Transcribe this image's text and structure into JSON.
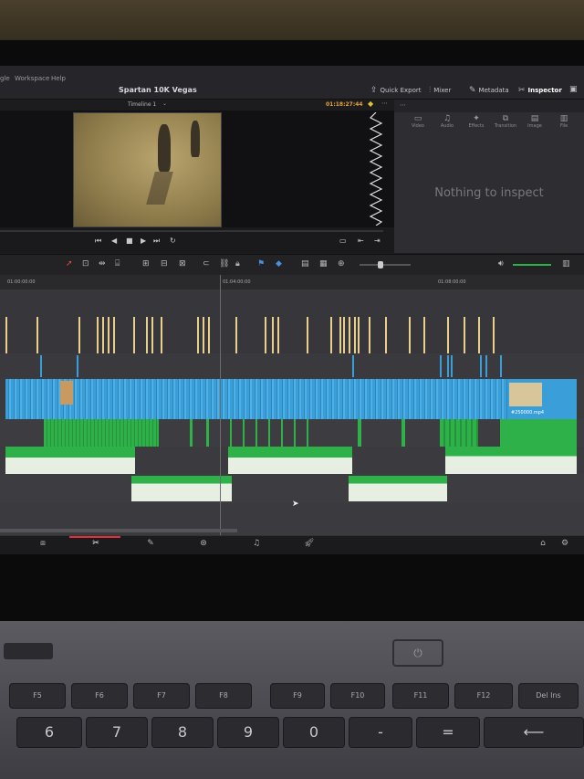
{
  "menu": [
    "gle",
    "Workspace",
    "Help"
  ],
  "project_title": "Spartan 10K Vegas",
  "toolbar_right": [
    {
      "icon": "quick-export-icon",
      "label": "Quick Export"
    },
    {
      "icon": "mixer-icon",
      "label": "Mixer"
    },
    {
      "icon": "metadata-icon",
      "label": "Metadata"
    },
    {
      "icon": "inspector-icon",
      "label": "Inspector"
    }
  ],
  "viewer": {
    "timeline_name": "Timeline 1",
    "timecode": "01:18:27:44"
  },
  "inspector": {
    "tabs": [
      "Video",
      "Audio",
      "Effects",
      "Transition",
      "Image",
      "File"
    ],
    "empty_message": "Nothing to inspect"
  },
  "ruler": {
    "ticks": [
      "01:00:00:00",
      "01:04:00:00",
      "01:08:00:00"
    ]
  },
  "audio_clip_label": "#250000.mp4",
  "pages": [
    "media-page-icon",
    "cut-page-icon",
    "edit-page-icon",
    "fusion-page-icon",
    "fairlight-page-icon",
    "deliver-page-icon"
  ],
  "keyboard": {
    "fkeys": [
      "F5",
      "F6",
      "F7",
      "F8",
      "F9",
      "F10",
      "F11",
      "F12",
      "Del Ins"
    ],
    "digits": [
      "6",
      "7",
      "8",
      "9",
      "0",
      "-",
      "="
    ],
    "shift_digits": [
      "^",
      "&",
      "*",
      "(",
      ")",
      "_",
      "+"
    ]
  },
  "colors": {
    "video": "#3a9fd8",
    "audio": "#2fb14a",
    "marker": "#e8d08a",
    "accent": "#e0303a",
    "timecode": "#e8a23a"
  }
}
